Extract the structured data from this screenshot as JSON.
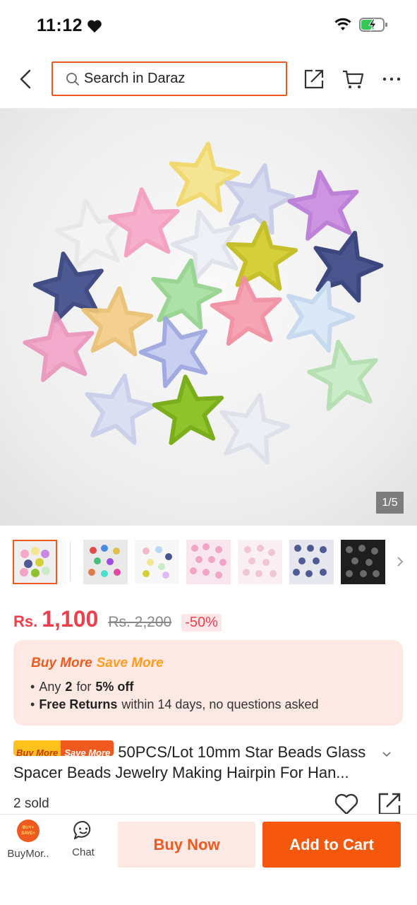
{
  "status_bar": {
    "time": "11:12"
  },
  "header": {
    "search_placeholder": "Search in Daraz"
  },
  "gallery": {
    "counter": "1/5",
    "thumbnail_count": 7
  },
  "price": {
    "currency": "Rs.",
    "current": "1,100",
    "original": "Rs. 2,200",
    "discount": "-50%"
  },
  "promo": {
    "title_part1": "Buy More",
    "title_part2": "Save More",
    "line1_prefix": "Any",
    "line1_bold_count": "2",
    "line1_for": "for",
    "line1_bold_off": "5% off",
    "line2_bold": "Free Returns",
    "line2_rest": "within 14 days, no questions asked"
  },
  "product": {
    "badge_part1": "Buy More",
    "badge_part2": "Save More",
    "title": "50PCS/Lot 10mm Star Beads Glass Spacer Beads Jewelry Making Hairpin For Han...",
    "sold": "2 sold"
  },
  "bottom_bar": {
    "buymore_label": "BuyMor..",
    "buymore_badge_line1": "BUY+",
    "buymore_badge_line2": "SAVE+",
    "chat_label": "Chat",
    "buy_now": "Buy Now",
    "add_to_cart": "Add to Cart"
  },
  "colors": {
    "accent": "#f05a1e",
    "price": "#f23d4a",
    "promo_bg": "#fde9e3"
  }
}
